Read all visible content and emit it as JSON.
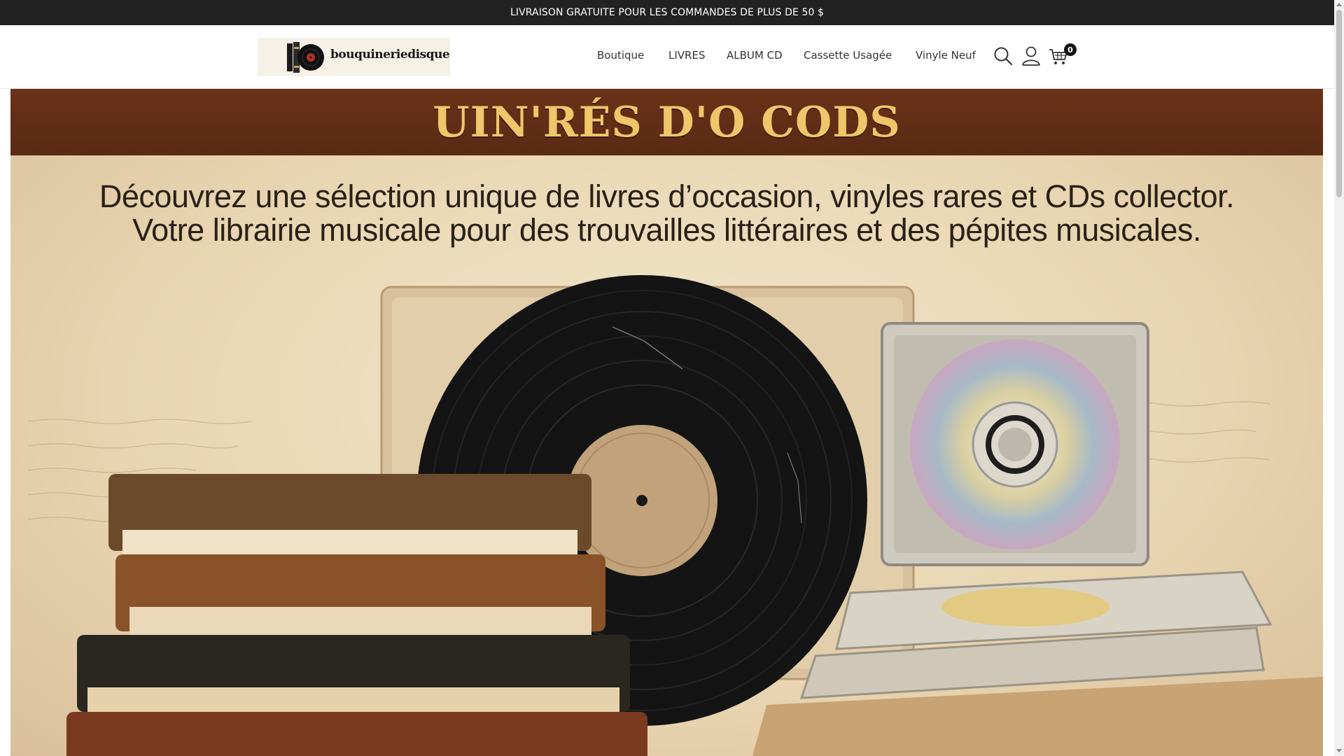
{
  "announcement": {
    "text": "LIVRAISON GRATUITE POUR LES COMMANDES DE PLUS DE 50 $"
  },
  "header": {
    "logo_text": "bouquineriedisque",
    "nav": [
      {
        "label": "Boutique"
      },
      {
        "label": "LIVRES"
      },
      {
        "label": "ALBUM CD"
      },
      {
        "label": "Cassette Usagée"
      },
      {
        "label": "Vinyle Neuf"
      }
    ],
    "icons": {
      "search": "search-icon",
      "account": "user-icon",
      "cart": "cart-icon"
    },
    "cart_count": "0"
  },
  "hero": {
    "banner_title": "UIN'RÉS D'O CODS",
    "line1": "Découvrez une sélection unique de livres d’occasion, vinyles rares et CDs collector.",
    "line2": "Votre librairie musicale pour des trouvailles littéraires et des pépites musicales."
  },
  "colors": {
    "announcement_bg": "#222222",
    "banner_bg": "#6b3118",
    "banner_text": "#efc66a",
    "hero_bg": "#ecdcc0"
  }
}
